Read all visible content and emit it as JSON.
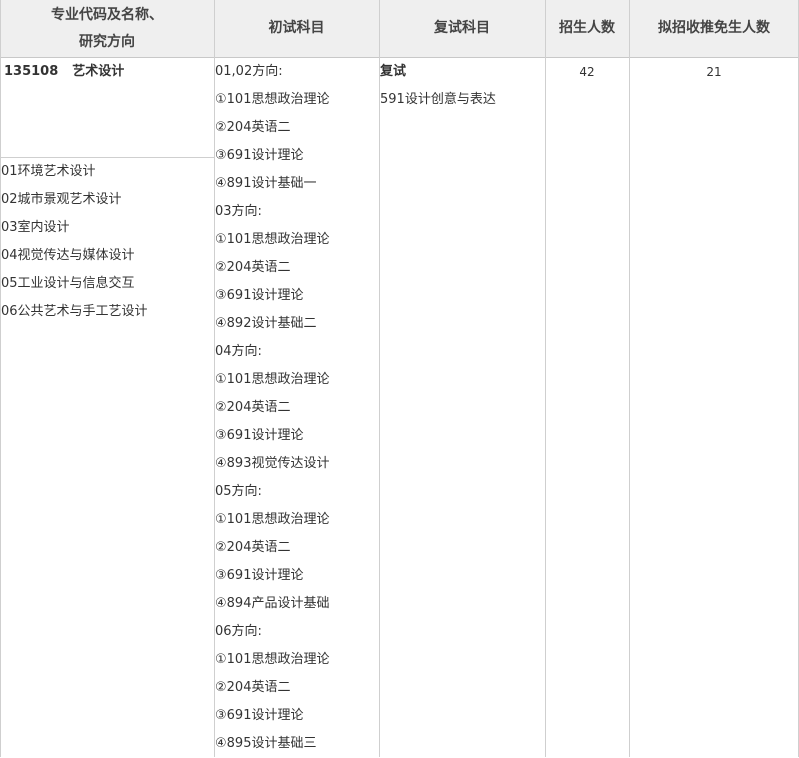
{
  "headers": {
    "major": [
      "专业代码及名称、",
      "研究方向"
    ],
    "initial": "初试科目",
    "retest": "复试科目",
    "enroll": "招生人数",
    "exempt": "拟招收推免生人数"
  },
  "major": {
    "code": "135108",
    "name": "艺术设计",
    "directions": [
      "01环境艺术设计",
      "02城市景观艺术设计",
      "03室内设计",
      "04视觉传达与媒体设计",
      "05工业设计与信息交互",
      "06公共艺术与手工艺设计"
    ]
  },
  "initial_subjects": [
    "01,02方向:",
    "①101思想政治理论",
    "②204英语二",
    "③691设计理论",
    "④891设计基础一",
    "03方向:",
    "①101思想政治理论",
    "②204英语二",
    "③691设计理论",
    "④892设计基础二",
    "04方向:",
    "①101思想政治理论",
    "②204英语二",
    "③691设计理论",
    "④893视觉传达设计",
    "05方向:",
    "①101思想政治理论",
    "②204英语二",
    "③691设计理论",
    "④894产品设计基础",
    "06方向:",
    "①101思想政治理论",
    "②204英语二",
    "③691设计理论",
    "④895设计基础三"
  ],
  "retest": {
    "title": "复试",
    "subject": "591设计创意与表达"
  },
  "enroll_count": "42",
  "exempt_count": "21"
}
